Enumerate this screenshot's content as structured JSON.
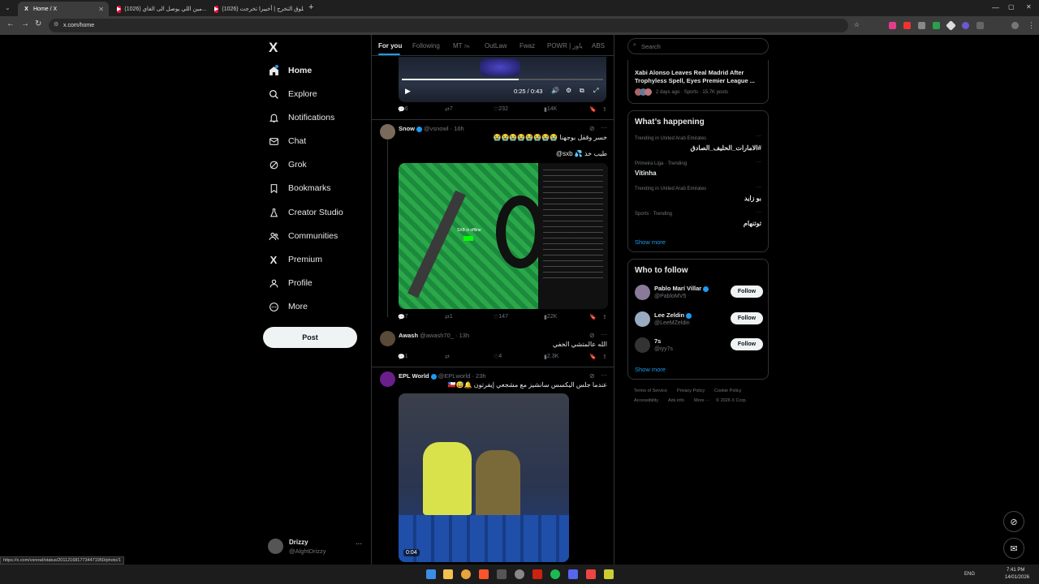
{
  "browser": {
    "tabs": [
      {
        "title": "Home / X",
        "active": true
      },
      {
        "title": "(1026) مين اللي يوصل الى الفاي...",
        "active": false
      },
      {
        "title": "(1026) قلوق التخرج | أخييرا تخرجت",
        "active": false
      }
    ],
    "new_tab": "+",
    "url": "x.com/home",
    "status_url": "https://x.com/vsnowl/status/2011216817734471950/photo/1"
  },
  "nav": {
    "logo": "X",
    "items": [
      {
        "label": "Home",
        "icon": "home-icon"
      },
      {
        "label": "Explore",
        "icon": "search-icon"
      },
      {
        "label": "Notifications",
        "icon": "bell-icon"
      },
      {
        "label": "Chat",
        "icon": "mail-icon"
      },
      {
        "label": "Grok",
        "icon": "grok-icon"
      },
      {
        "label": "Bookmarks",
        "icon": "bookmark-icon"
      },
      {
        "label": "Creator Studio",
        "icon": "flask-icon"
      },
      {
        "label": "Communities",
        "icon": "people-icon"
      },
      {
        "label": "Premium",
        "icon": "x-icon"
      },
      {
        "label": "Profile",
        "icon": "person-icon"
      },
      {
        "label": "More",
        "icon": "more-circle-icon"
      }
    ],
    "post_label": "Post",
    "account": {
      "name": "Drizzy",
      "handle": "@AlghtDrizzy",
      "menu": "···"
    }
  },
  "feed": {
    "tabs": [
      "For you",
      "Following",
      "MT",
      "OutLaw",
      "Fwaz",
      "POWR | باور",
      "ABS"
    ],
    "mt_badge": "7m",
    "video": {
      "time": "0:25 / 0:43"
    },
    "post0_actions": {
      "replies": "6",
      "reposts": "7",
      "likes": "232",
      "views": "14K"
    },
    "posts": [
      {
        "name": "Snow",
        "handle": "@vsnowl",
        "time": "16h",
        "text1": "خسر وقفل بوجهنا 😭😭😭😭😭😭😭😭",
        "text2": "طيب خذ 💦 sxb@",
        "stream_text": "SXB is offline",
        "actions": {
          "replies": "7",
          "reposts": "1",
          "likes": "147",
          "views": "22K"
        }
      },
      {
        "name": "Awash",
        "handle": "@awash70_",
        "time": "13h",
        "text1": "الله عالمتشي الخفي",
        "actions": {
          "replies": "1",
          "reposts": "",
          "likes": "4",
          "views": "2.3K"
        }
      },
      {
        "name": "EPL World",
        "handle": "@EPLworld",
        "time": "23h",
        "text1": "عندما جلس اليكسس سانشيز مع مشجعي إيفرتون 🔔😅🇨🇱",
        "video_time": "0:04"
      }
    ]
  },
  "right": {
    "search_placeholder": "Search",
    "news": {
      "title": "Xabi Alonso Leaves Real Madrid After Trophyless Spell, Eyes Premier League ...",
      "meta": "2 days ago · Sports · 15.7K posts"
    },
    "happening": {
      "title": "What’s happening",
      "trends": [
        {
          "context": "Trending in United Arab Emirates",
          "name": "#الامارات_الحليف_الصادق"
        },
        {
          "context": "Primeira Liga · Trending",
          "name": "Vitinha"
        },
        {
          "context": "Trending in United Arab Emirates",
          "name": "بو زايد"
        },
        {
          "context": "Sports · Trending",
          "name": "توتنهام"
        }
      ],
      "show_more": "Show more"
    },
    "who_to_follow": {
      "title": "Who to follow",
      "users": [
        {
          "name": "Pablo Marí Villar",
          "handle": "@PabloMV5"
        },
        {
          "name": "Lee Zeldin",
          "handle": "@LeeMZeldin"
        },
        {
          "name": "7s",
          "handle": "@iyy7s"
        }
      ],
      "follow_label": "Follow",
      "show_more": "Show more"
    },
    "footer": [
      "Terms of Service",
      "Privacy Policy",
      "Cookie Policy",
      "Accessibility",
      "Ads info",
      "More ···",
      "© 2026 X Corp."
    ]
  },
  "taskbar": {
    "lang": "ENG",
    "time": "7:41 PM",
    "date": "14/01/2026"
  },
  "colors": {
    "accent": "#1d9bf0",
    "bg": "#000000",
    "border": "#2f3336",
    "muted": "#71767b"
  }
}
